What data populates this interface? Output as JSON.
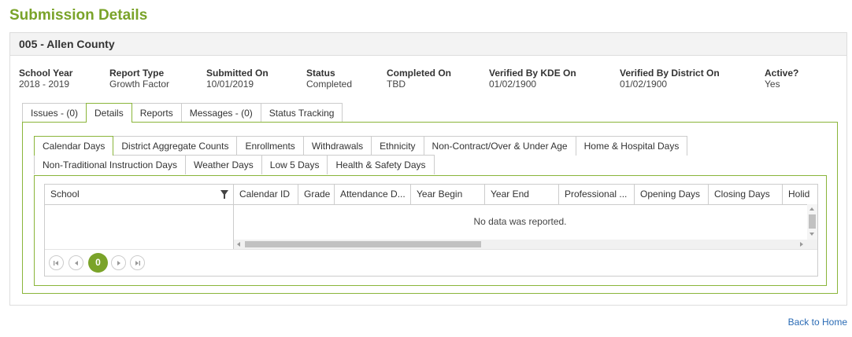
{
  "page": {
    "title": "Submission Details"
  },
  "panel": {
    "heading": "005 - Allen County"
  },
  "info": [
    {
      "label": "School Year",
      "value": "2018 - 2019"
    },
    {
      "label": "Report Type",
      "value": "Growth Factor"
    },
    {
      "label": "Submitted On",
      "value": "10/01/2019"
    },
    {
      "label": "Status",
      "value": "Completed"
    },
    {
      "label": "Completed On",
      "value": "TBD"
    },
    {
      "label": "Verified By KDE On",
      "value": "01/02/1900"
    },
    {
      "label": "Verified By District On",
      "value": "01/02/1900"
    },
    {
      "label": "Active?",
      "value": "Yes"
    }
  ],
  "main_tabs": [
    {
      "label": "Issues - (0)",
      "active": false
    },
    {
      "label": "Details",
      "active": true
    },
    {
      "label": "Reports",
      "active": false
    },
    {
      "label": "Messages - (0)",
      "active": false
    },
    {
      "label": "Status Tracking",
      "active": false
    }
  ],
  "sub_tabs": [
    {
      "label": "Calendar Days",
      "active": true
    },
    {
      "label": "District Aggregate Counts",
      "active": false
    },
    {
      "label": "Enrollments",
      "active": false
    },
    {
      "label": "Withdrawals",
      "active": false
    },
    {
      "label": "Ethnicity",
      "active": false
    },
    {
      "label": "Non-Contract/Over & Under Age",
      "active": false
    },
    {
      "label": "Home & Hospital Days",
      "active": false
    },
    {
      "label": "Non-Traditional Instruction Days",
      "active": false
    },
    {
      "label": "Weather Days",
      "active": false
    },
    {
      "label": "Low 5 Days",
      "active": false
    },
    {
      "label": "Health & Safety Days",
      "active": false
    }
  ],
  "grid": {
    "columns": [
      "School",
      "Calendar ID",
      "Grade",
      "Attendance D...",
      "Year Begin",
      "Year End",
      "Professional ...",
      "Opening Days",
      "Closing Days",
      "Holid"
    ],
    "empty_message": "No data was reported.",
    "current_page": "0"
  },
  "footer": {
    "back_link": "Back to Home"
  },
  "colors": {
    "accent": "#7aa329",
    "tab_border": "#8ab53a",
    "link": "#2a6bb5"
  }
}
